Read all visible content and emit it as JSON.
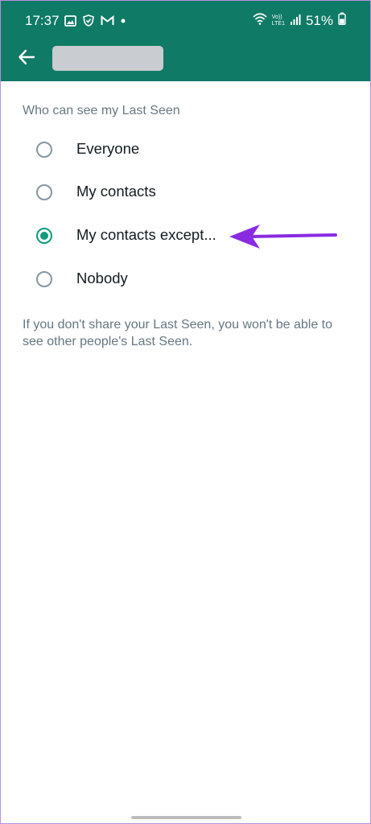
{
  "status_bar": {
    "time": "17:37",
    "network_label_top": "Vo))",
    "network_label_bottom": "LTE1",
    "battery": "51%"
  },
  "header": {
    "back_icon": "arrow-left-icon",
    "title": ""
  },
  "last_seen": {
    "heading": "Who can see my Last Seen",
    "options": [
      {
        "label": "Everyone",
        "selected": false
      },
      {
        "label": "My contacts",
        "selected": false
      },
      {
        "label": "My contacts except...",
        "selected": true
      },
      {
        "label": "Nobody",
        "selected": false
      }
    ],
    "note": "If you don't share your Last Seen, you won't be able to see other people's Last Seen."
  },
  "colors": {
    "app_bar": "#0f7a66",
    "radio_selected": "#0f9b7c",
    "annotation_arrow": "#8a2be2"
  }
}
